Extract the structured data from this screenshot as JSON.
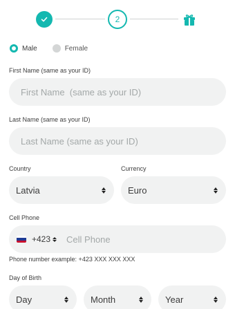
{
  "stepper": {
    "step1_icon": "check-icon",
    "step2_number": "2",
    "step3_icon": "gift-icon",
    "accent_color": "#14b8b0"
  },
  "gender": {
    "options": [
      {
        "label": "Male",
        "selected": true
      },
      {
        "label": "Female",
        "selected": false
      }
    ]
  },
  "first_name": {
    "label": "First Name (same as your ID)",
    "placeholder": "First Name  (same as your ID)"
  },
  "last_name": {
    "label": "Last Name (same as your ID)",
    "placeholder": "Last Name (same as your ID)"
  },
  "country": {
    "label": "Country",
    "value": "Latvia"
  },
  "currency": {
    "label": "Currency",
    "value": "Euro"
  },
  "cell_phone": {
    "label": "Cell Phone",
    "country_code": "+423",
    "placeholder": "Cell Phone",
    "hint": "Phone number example: +423 XXX XXX XXX"
  },
  "birth": {
    "label": "Day of Birth",
    "day": "Day",
    "month": "Month",
    "year": "Year"
  }
}
